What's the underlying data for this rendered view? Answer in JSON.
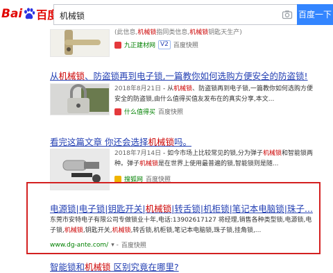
{
  "header": {
    "logo": {
      "part1": "Bai",
      "part2": "百度"
    },
    "search_value": "机械锁",
    "search_button": "百度一下"
  },
  "results": [
    {
      "abstract_top": "(此信息,机械锁指同类信息,机械锁钥匙天生产)",
      "source": "九正建材网",
      "badge": "V2",
      "snapshot": "百度快照"
    },
    {
      "title": "从机械锁、防盗锁再到电子锁,一篇教你如何选购方便安全的防盗锁!",
      "date": "2018年8月21日",
      "abstract": " - 从机械锁、防盗锁再到电子锁,一篇教你如何选购方便安全的防盗锁,由什么值得买值友发布在的真实分享,本文...",
      "source": "什么值得买",
      "snapshot": "百度快照"
    },
    {
      "title": "看完这篇文章 你还会选择机械锁吗。",
      "date": "2018年7月14日",
      "abstract": " - 如今市场上比较常见的锁,分为弹子机械锁和智能锁两种。弹子机械锁是在世界上使用最普遍的锁,智能锁则是随...",
      "source": "搜狐网",
      "snapshot": "百度快照"
    },
    {
      "title": "电源锁|电子锁|钥匙开关|机械锁|转舌锁|机柜锁|笔记本电脑锁|珠子...",
      "abstract": "东莞市安特电子有限公司专做锁业十年,电话:13902617127 将经理,销售各种类型锁,电源锁,电子锁,机械锁,钥匙开关,机械锁,转舌锁,机柜锁,笔记本电脑锁,珠子锁,挂角锁,...",
      "url": "www.dg-ante.com/",
      "snapshot": "百度快照"
    },
    {
      "title": "智能锁和机械锁 区别究竟在哪里?"
    }
  ]
}
